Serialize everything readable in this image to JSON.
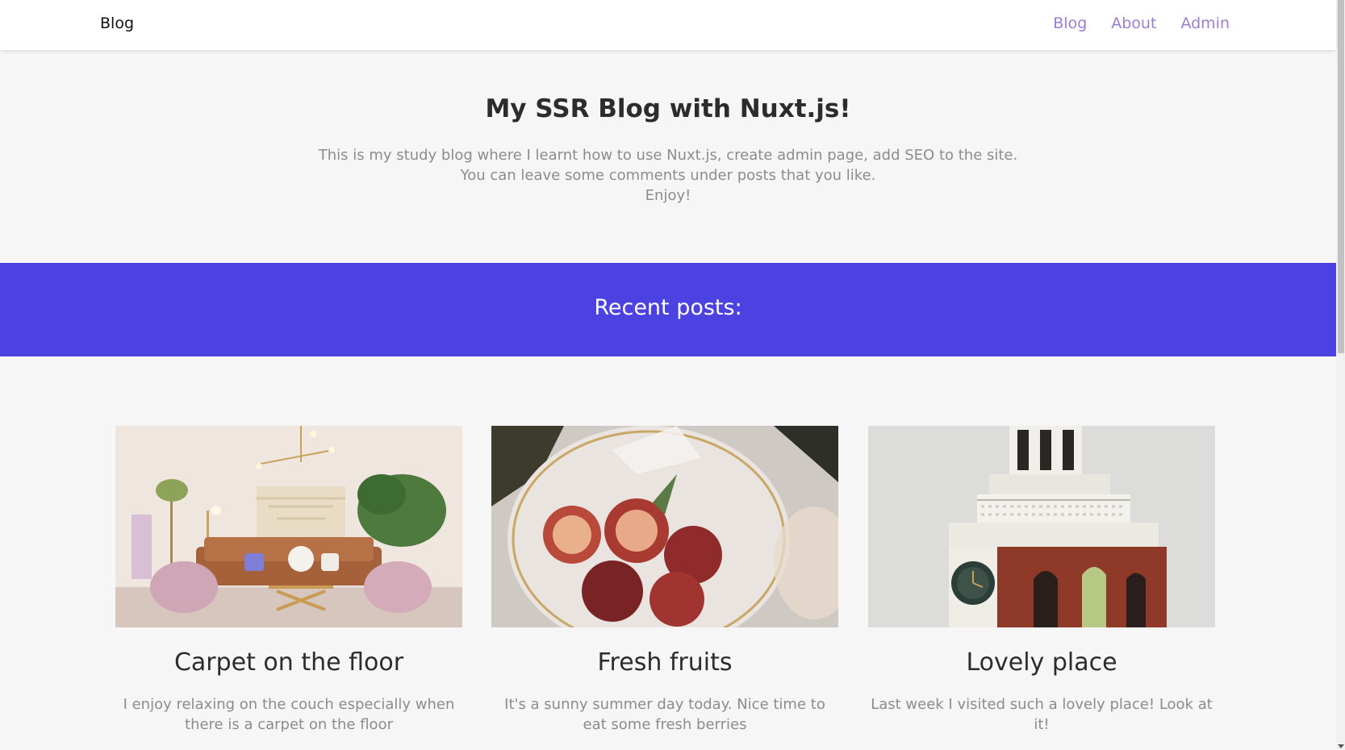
{
  "nav": {
    "brand": "Blog",
    "links": [
      "Blog",
      "About",
      "Admin"
    ]
  },
  "intro": {
    "title": "My SSR Blog with Nuxt.js!",
    "lines": [
      "This is my study blog where I learnt how to use Nuxt.js, create admin page, add SEO to the site.",
      "You can leave some comments under posts that you like.",
      "Enjoy!"
    ]
  },
  "banner": {
    "title": "Recent posts:"
  },
  "posts": [
    {
      "title": "Carpet on the floor",
      "text": "I enjoy relaxing on the couch especially when there is a carpet on the floor",
      "image": "living-room-photo"
    },
    {
      "title": "Fresh fruits",
      "text": "It's a sunny summer day today. Nice time to eat some fresh berries",
      "image": "peaches-plate-photo"
    },
    {
      "title": "Lovely place",
      "text": "Last week I visited such a lovely place! Look at it!",
      "image": "clock-tower-photo"
    }
  ],
  "colors": {
    "accent": "#4b42e1",
    "nav_link": "#9a7fd0",
    "background": "#f6f6f6"
  }
}
